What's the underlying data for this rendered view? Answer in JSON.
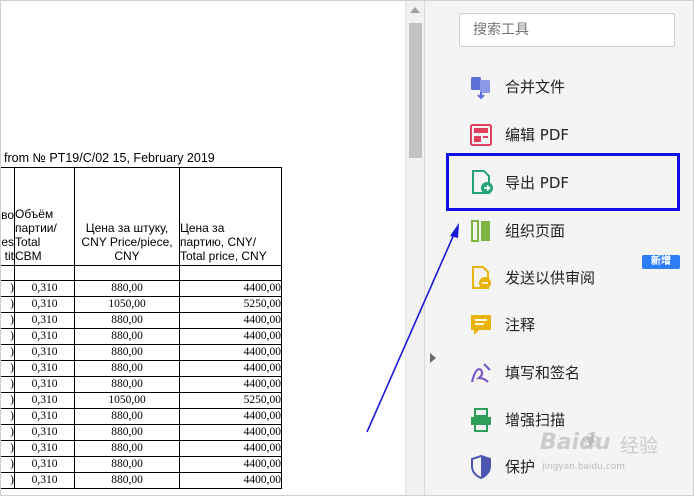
{
  "document": {
    "heading": "from № PT19/C/02 15, February 2019",
    "columns": [
      [
        "во",
        "es",
        "tit"
      ],
      [
        "Объём",
        "партии/",
        "Total",
        "CBM"
      ],
      [
        "Цена за штуку,",
        "CNY Price/piece,",
        "CNY"
      ],
      [
        "Цена за",
        "партию, CNY/",
        "Total price, CNY"
      ]
    ],
    "rows": [
      [
        ")",
        "0,310",
        "880,00",
        "4400,00"
      ],
      [
        ")",
        "0,310",
        "1050,00",
        "5250,00"
      ],
      [
        ")",
        "0,310",
        "880,00",
        "4400,00"
      ],
      [
        ")",
        "0,310",
        "880,00",
        "4400,00"
      ],
      [
        ")",
        "0,310",
        "880,00",
        "4400,00"
      ],
      [
        ")",
        "0,310",
        "880,00",
        "4400,00"
      ],
      [
        ")",
        "0,310",
        "880,00",
        "4400,00"
      ],
      [
        ")",
        "0,310",
        "1050,00",
        "5250,00"
      ],
      [
        ")",
        "0,310",
        "880,00",
        "4400,00"
      ],
      [
        ")",
        "0,310",
        "880,00",
        "4400,00"
      ],
      [
        ")",
        "0,310",
        "880,00",
        "4400,00"
      ],
      [
        ")",
        "0,310",
        "880,00",
        "4400,00"
      ],
      [
        ")",
        "0,310",
        "880,00",
        "4400,00"
      ]
    ]
  },
  "tools_panel": {
    "search_placeholder": "搜索工具",
    "items": [
      {
        "label": "合并文件",
        "icon": "combine-files-icon",
        "color": "#5b6fd6"
      },
      {
        "label": "编辑 PDF",
        "icon": "edit-pdf-icon",
        "color": "#e0405e"
      },
      {
        "label": "导出 PDF",
        "icon": "export-pdf-icon",
        "color": "#27a37a"
      },
      {
        "label": "组织页面",
        "icon": "organize-pages-icon",
        "color": "#7cb342"
      },
      {
        "label": "发送以供审阅",
        "icon": "send-for-review-icon",
        "color": "#e8b40c"
      },
      {
        "label": "注释",
        "icon": "comment-icon",
        "color": "#e8b40c"
      },
      {
        "label": "填写和签名",
        "icon": "fill-sign-icon",
        "color": "#7a5cc8"
      },
      {
        "label": "增强扫描",
        "icon": "enhance-scan-icon",
        "color": "#2e9e5b"
      },
      {
        "label": "保护",
        "icon": "protect-icon",
        "color": "#4a56b0"
      }
    ],
    "new_badge": "新增",
    "selected_item": "导出 PDF"
  },
  "watermark": {
    "logo": "Baidu",
    "suffix": "经验",
    "url": "jingyan.baidu.com"
  },
  "colors": {
    "highlight_box": "#1010e6",
    "annotation_arrow": "#1a1ad6",
    "badge": "#2d7ef7"
  }
}
